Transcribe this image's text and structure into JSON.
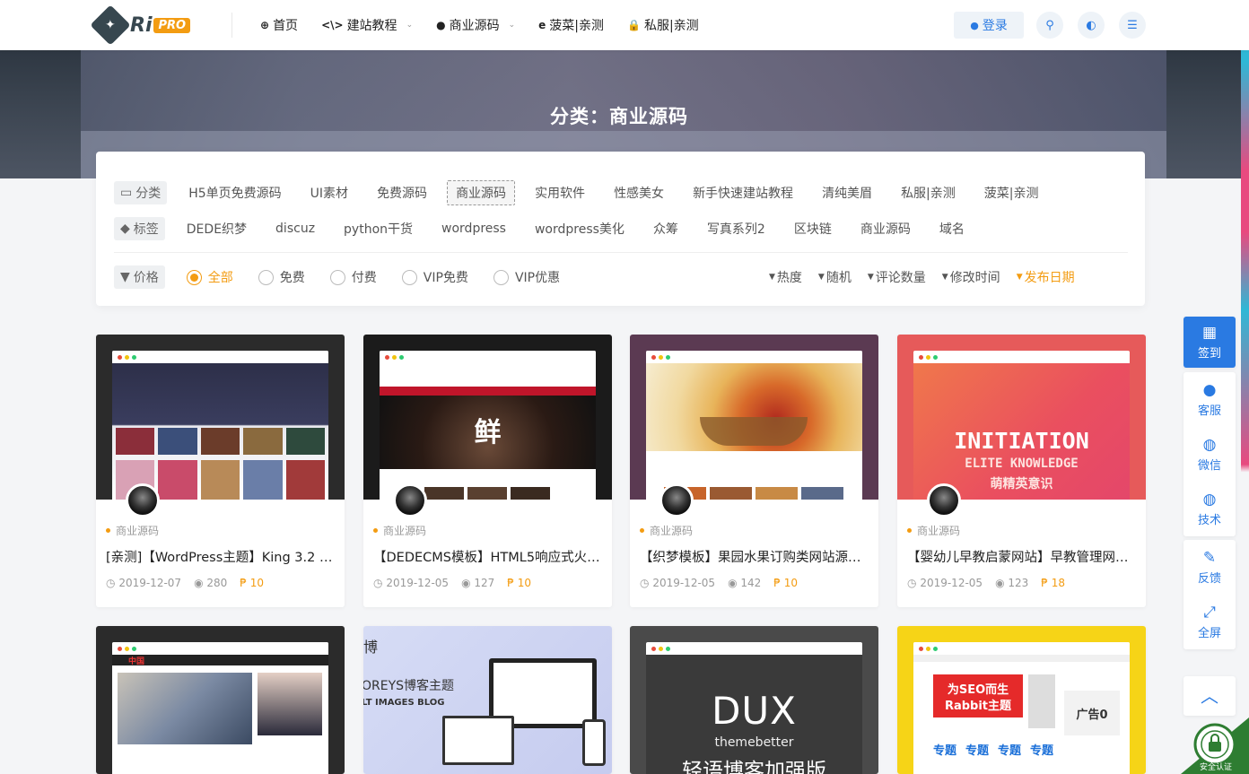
{
  "header": {
    "logo_ri": "Ri",
    "logo_pro": "PRO",
    "nav": [
      {
        "icon": "globe-icon",
        "glyph": "⊕",
        "label": "首页",
        "caret": false
      },
      {
        "icon": "code-icon",
        "glyph": "<\\>",
        "label": "建站教程",
        "caret": true
      },
      {
        "icon": "apple-icon",
        "glyph": "●",
        "label": "商业源码",
        "caret": true
      },
      {
        "icon": "edge-icon",
        "glyph": "e",
        "label": "菠菜|亲测",
        "caret": false
      },
      {
        "icon": "lock-icon",
        "glyph": "🔒",
        "label": "私服|亲测",
        "caret": false
      }
    ],
    "login_label": "登录"
  },
  "hero": {
    "title": "分类：商业源码"
  },
  "filter": {
    "category_label": "分类",
    "categories": [
      "H5单页免费源码",
      "UI素材",
      "免费源码",
      "商业源码",
      "实用软件",
      "性感美女",
      "新手快速建站教程",
      "清纯美眉",
      "私服|亲测",
      "菠菜|亲测"
    ],
    "active_category": "商业源码",
    "tag_label": "标签",
    "tags": [
      "DEDE织梦",
      "discuz",
      "python干货",
      "wordpress",
      "wordpress美化",
      "众筹",
      "写真系列2",
      "区块链",
      "商业源码",
      "域名"
    ],
    "price_label": "价格",
    "prices": [
      "全部",
      "免费",
      "付费",
      "VIP免费",
      "VIP优惠"
    ],
    "active_price": "全部",
    "sorts": [
      "热度",
      "随机",
      "评论数量",
      "修改时间",
      "发布日期"
    ],
    "active_sort": "发布日期"
  },
  "cards": [
    {
      "category": "商业源码",
      "title": "[亲测]【WordPress主题】King 3.2 汉…",
      "date": "2019-12-07",
      "views": "280",
      "price": "10"
    },
    {
      "category": "商业源码",
      "title": "【DEDECMS模板】HTML5响应式火…",
      "date": "2019-12-05",
      "views": "127",
      "price": "10"
    },
    {
      "category": "商业源码",
      "title": "【织梦模板】果园水果订购类网站源…",
      "date": "2019-12-05",
      "views": "142",
      "price": "10"
    },
    {
      "category": "商业源码",
      "title": "【婴幼儿早教启蒙网站】早教管理网…",
      "date": "2019-12-05",
      "views": "123",
      "price": "18"
    }
  ],
  "thumb_texts": {
    "c2_char": "鲜",
    "c4_line1": "INITIATION",
    "c4_line2": "ELITE KNOWLEDGE",
    "c4_line3": "萌精英意识",
    "c6_line1": "博",
    "c6_line2": "OREYS博客主题",
    "c6_line3": "LT IMAGES BLOG",
    "c7_line1": "DUX",
    "c7_line2": "themebetter",
    "c7_line3": "轻语博客加强版",
    "c8_line1": "为SEO而生",
    "c8_line2": "Rabbit主题",
    "c8_ad": "广告0",
    "c8_topic": "专题",
    "c5_logo": "中国"
  },
  "side_tools": [
    {
      "icon": "calendar-icon",
      "glyph": "▦",
      "label": "签到",
      "primary": true
    },
    {
      "icon": "qq-icon",
      "glyph": "●",
      "label": "客服"
    },
    {
      "icon": "wechat-icon",
      "glyph": "◍",
      "label": "微信"
    },
    {
      "icon": "wechat-tech-icon",
      "glyph": "◍",
      "label": "技术"
    },
    {
      "icon": "edit-icon",
      "glyph": "✎",
      "label": "反馈"
    },
    {
      "icon": "fullscreen-icon",
      "glyph": "⤢",
      "label": "全屏"
    }
  ],
  "back_top_glyph": "︿",
  "badge_label": "安全认证",
  "colors": {
    "accent": "#f39c12",
    "primary": "#2a7ae2",
    "header_bg": "#ffffff",
    "page_bg": "#f4f5f7"
  }
}
